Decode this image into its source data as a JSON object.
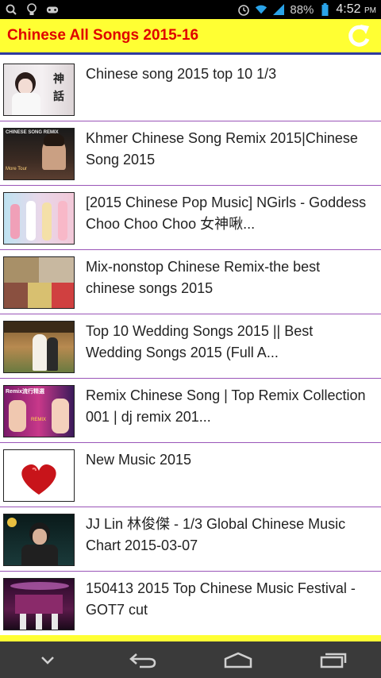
{
  "status": {
    "battery": "88%",
    "time": "4:52",
    "ampm": "PM",
    "left_icons": [
      "search-icon",
      "lightbulb-icon",
      "gamepad-icon"
    ],
    "right_icons": [
      "alarm-icon",
      "wifi-icon",
      "signal-icon",
      "battery-icon"
    ]
  },
  "app": {
    "title": "Chinese All Songs 2015-16",
    "refresh_icon": "refresh-icon",
    "accent": "#ffff33",
    "title_color": "#e00000"
  },
  "list": {
    "items": [
      {
        "title": "Chinese song 2015 top 10  1/3",
        "thumb": "thumb-girl-white"
      },
      {
        "title": "Khmer Chinese Song Remix 2015|Chinese Song 2015",
        "thumb": "thumb-remix-dark"
      },
      {
        "title": "[2015 Chinese Pop Music] NGirls - Goddess Choo Choo Choo 女神啾...",
        "thumb": "thumb-girls-group"
      },
      {
        "title": "Mix-nonstop Chinese Remix-the best chinese songs 2015",
        "thumb": "thumb-collage"
      },
      {
        "title": "Top 10 Wedding Songs 2015 || Best Wedding Songs 2015 (Full A...",
        "thumb": "thumb-wedding"
      },
      {
        "title": "Remix Chinese Song | Top Remix Collection 001 | dj remix 201...",
        "thumb": "thumb-remix-pink"
      },
      {
        "title": "New Music 2015",
        "thumb": "thumb-heart"
      },
      {
        "title": "JJ Lin 林俊傑 - 1/3 Global Chinese Music Chart 2015-03-07",
        "thumb": "thumb-singer"
      },
      {
        "title": "150413 2015 Top Chinese Music Festival - GOT7 cut",
        "thumb": "thumb-stage"
      }
    ]
  },
  "nav": {
    "icons": [
      "chevron-down-icon",
      "back-icon",
      "home-icon",
      "recents-icon"
    ]
  }
}
